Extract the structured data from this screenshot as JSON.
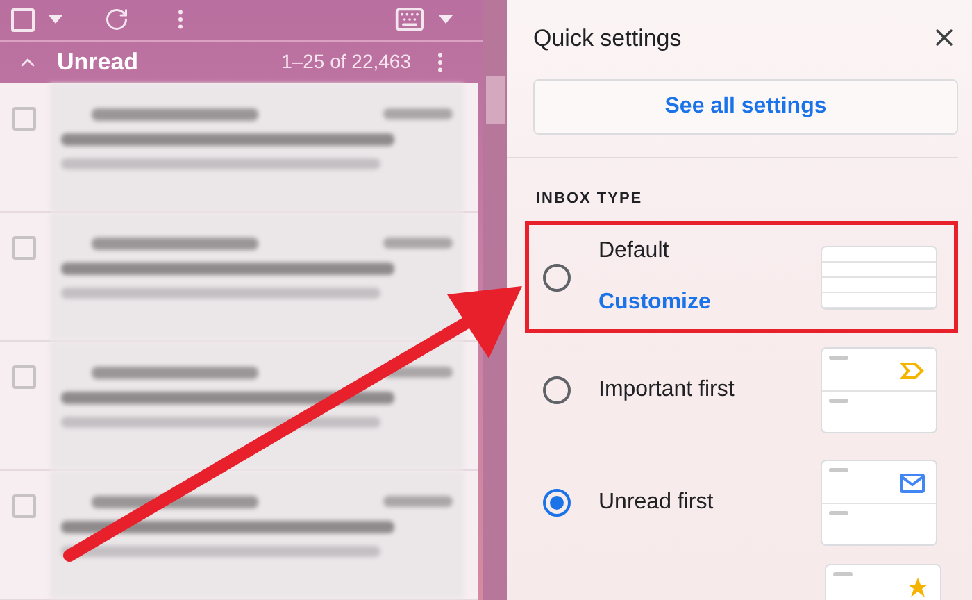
{
  "toolbar": {
    "select_all_checked": false
  },
  "mail_list": {
    "section_title": "Unread",
    "range": "1–25 of 22,463",
    "expanded": true,
    "rows": [
      {
        "checked": false
      },
      {
        "checked": false
      },
      {
        "checked": false
      },
      {
        "checked": false
      }
    ]
  },
  "quick_settings": {
    "title": "Quick settings",
    "see_all_button": "See all settings",
    "section_label": "INBOX TYPE",
    "options": [
      {
        "kind": "default",
        "label": "Default",
        "link": "Customize",
        "selected": false,
        "highlighted": true
      },
      {
        "kind": "important",
        "label": "Important first",
        "selected": false,
        "highlighted": false
      },
      {
        "kind": "unread",
        "label": "Unread first",
        "selected": true,
        "highlighted": false
      }
    ],
    "next_option_preview": {
      "kind": "starred"
    }
  }
}
